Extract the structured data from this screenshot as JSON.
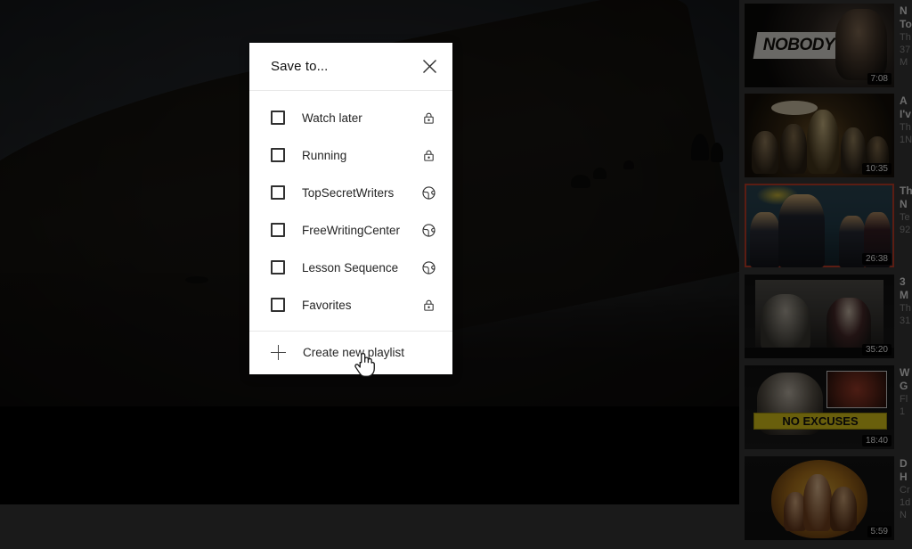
{
  "dialog": {
    "title": "Save to...",
    "close_icon": "close-icon",
    "playlists": [
      {
        "label": "Watch later",
        "privacy": "private",
        "privacy_icon": "lock-icon",
        "checked": false
      },
      {
        "label": "Running",
        "privacy": "private",
        "privacy_icon": "lock-icon",
        "checked": false
      },
      {
        "label": "TopSecretWriters",
        "privacy": "public",
        "privacy_icon": "globe-icon",
        "checked": false
      },
      {
        "label": "FreeWritingCenter",
        "privacy": "public",
        "privacy_icon": "globe-icon",
        "checked": false
      },
      {
        "label": "Lesson Sequence",
        "privacy": "public",
        "privacy_icon": "globe-icon",
        "checked": false
      },
      {
        "label": "Favorites",
        "privacy": "private",
        "privacy_icon": "lock-icon",
        "checked": false
      }
    ],
    "create_new": {
      "label": "Create new playlist",
      "icon": "plus-icon"
    }
  },
  "player": {
    "state": "paused-dimmed",
    "scene": "dark night landscape with hillside silhouette"
  },
  "sidebar": {
    "items": [
      {
        "duration": "7:08",
        "title_fragment": "N",
        "line2_fragment": "To",
        "line3_fragment": "Th",
        "line4_fragment": "37",
        "line5_fragment": "M",
        "plate_text": "NOBODY",
        "active": false
      },
      {
        "duration": "10:35",
        "title_fragment": "A",
        "line2_fragment": "I'v",
        "line3_fragment": "Th",
        "line4_fragment": "1N",
        "line5_fragment": "",
        "active": false
      },
      {
        "duration": "26:38",
        "title_fragment": "Th",
        "line2_fragment": "N",
        "line3_fragment": "Te",
        "line4_fragment": "92",
        "line5_fragment": "",
        "active": true
      },
      {
        "duration": "35:20",
        "title_fragment": "3",
        "line2_fragment": "M",
        "line3_fragment": "Th",
        "line4_fragment": "31",
        "line5_fragment": "",
        "active": false
      },
      {
        "duration": "18:40",
        "title_fragment": "W",
        "line2_fragment": "G",
        "line3_fragment": "Fl",
        "line4_fragment": "1",
        "line5_fragment": "",
        "band_text": "NO EXCUSES",
        "active": false
      },
      {
        "duration": "5:59",
        "title_fragment": "D",
        "line2_fragment": "H",
        "line3_fragment": "Cr",
        "line4_fragment": "1d",
        "line5_fragment": "N",
        "active": false
      }
    ]
  },
  "colors": {
    "dialog_bg": "#ffffff",
    "dialog_text": "#252525",
    "page_bg": "#3a3a3a",
    "scrim": "rgba(0,0,0,0.55)",
    "active_thumb_border": "#c9402c",
    "duration_bg": "rgba(0,0,0,0.82)"
  }
}
